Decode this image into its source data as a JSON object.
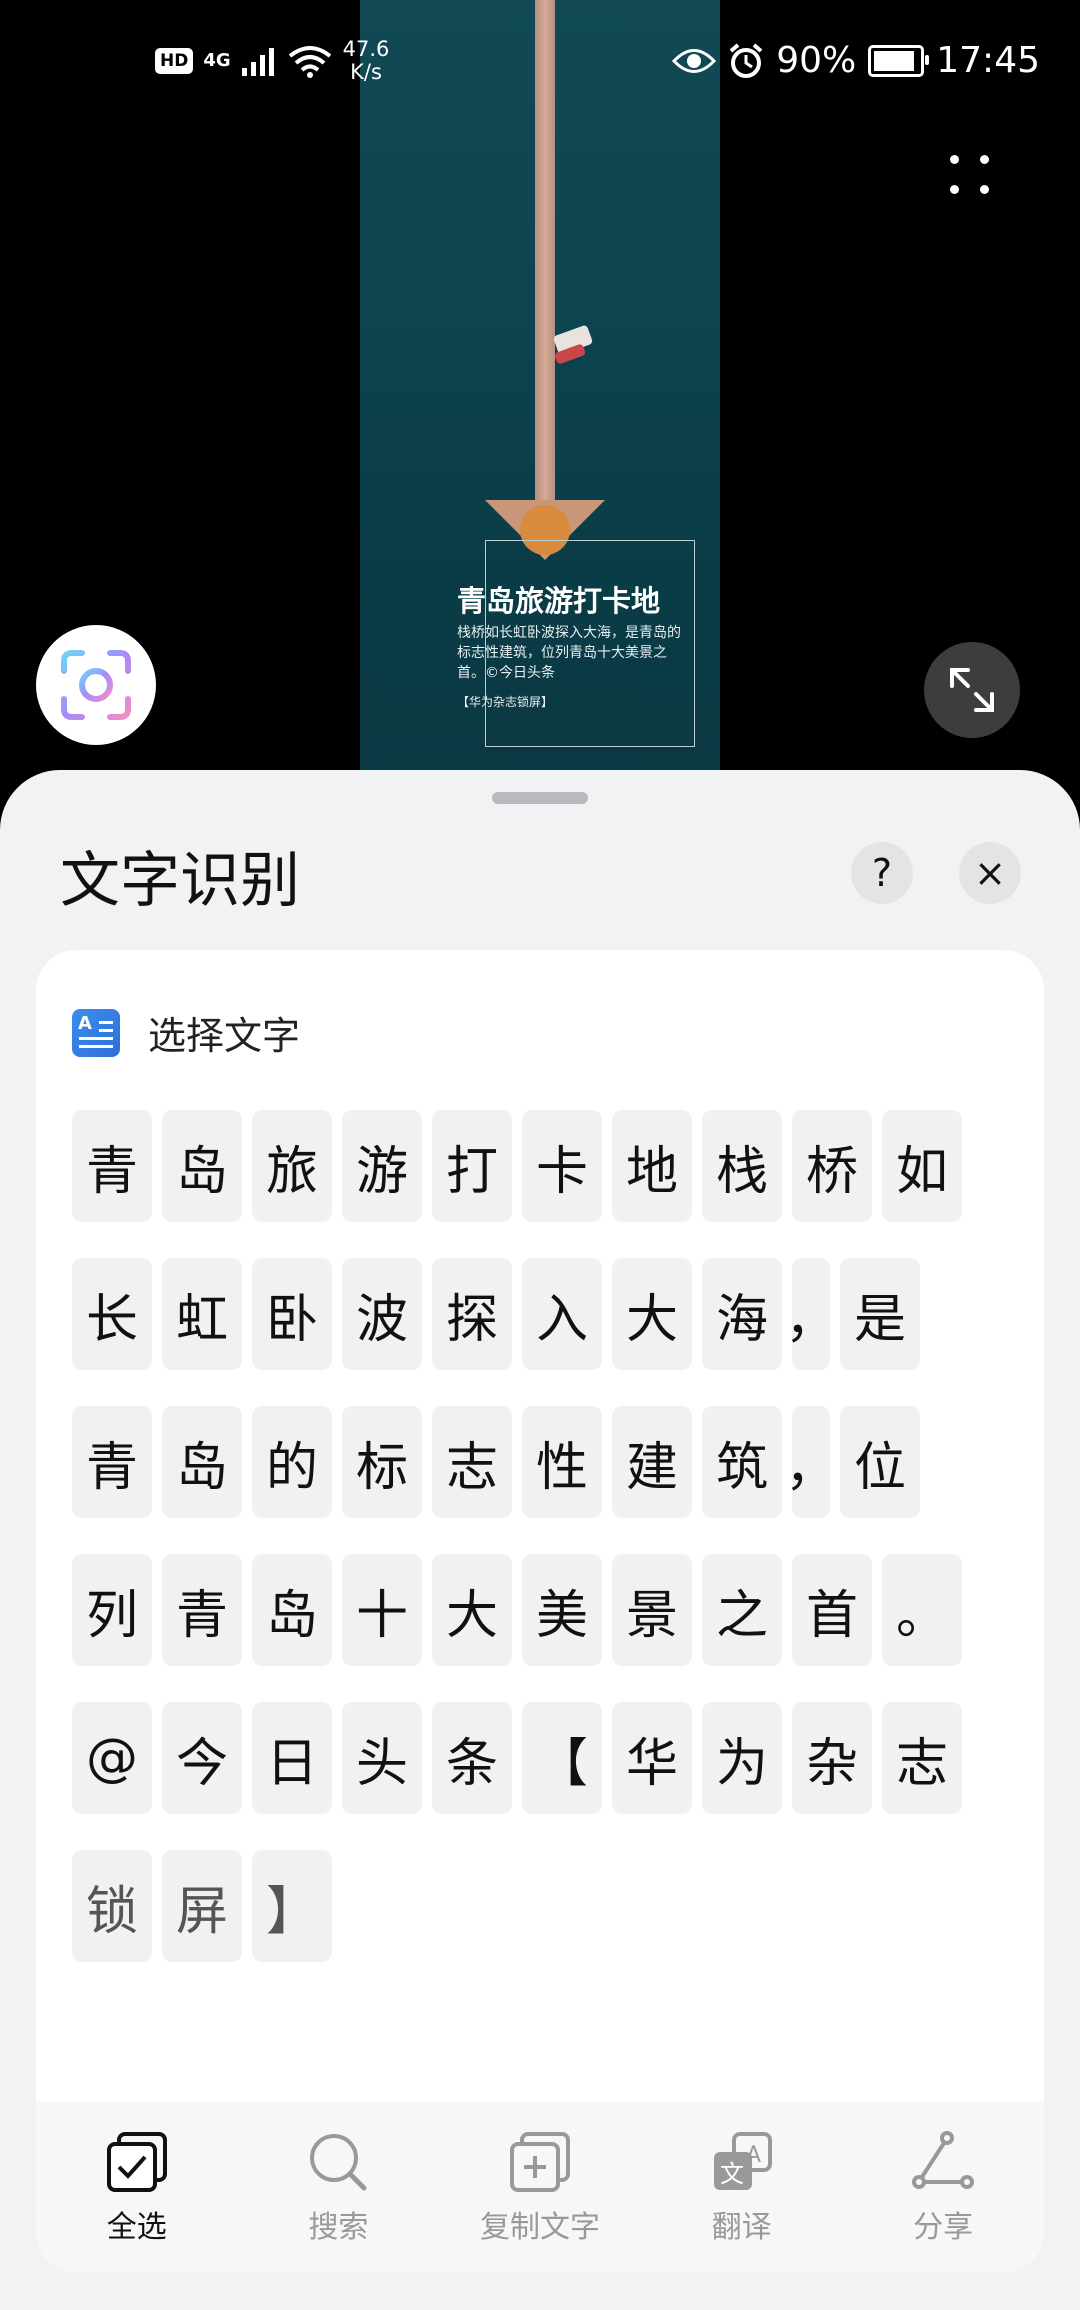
{
  "status_bar": {
    "hd": "HD",
    "network": "4G",
    "speed_value": "47.6",
    "speed_unit": "K/s",
    "battery": "90%",
    "battery_level": 0.9,
    "time": "17:45"
  },
  "wallpaper": {
    "title": "青岛旅游打卡地",
    "description": "栈桥如长虹卧波探入大海，是青岛的标志性建筑，位列青岛十大美景之首。©今日头条",
    "tag": "【华为杂志锁屏】"
  },
  "sheet": {
    "title": "文字识别",
    "help": "?",
    "close": "×",
    "section_label": "选择文字"
  },
  "char_rows": [
    [
      "青",
      "岛",
      "旅",
      "游",
      "打",
      "卡",
      "地",
      "栈",
      "桥",
      "如"
    ],
    [
      "长",
      "虹",
      "卧",
      "波",
      "探",
      "入",
      "大",
      "海",
      "，",
      "是"
    ],
    [
      "青",
      "岛",
      "的",
      "标",
      "志",
      "性",
      "建",
      "筑",
      "，",
      "位"
    ],
    [
      "列",
      "青",
      "岛",
      "十",
      "大",
      "美",
      "景",
      "之",
      "首",
      "。"
    ],
    [
      "@",
      "今",
      "日",
      "头",
      "条",
      "【",
      "华",
      "为",
      "杂",
      "志"
    ],
    [
      "锁",
      "屏",
      "】"
    ]
  ],
  "toolbar": {
    "select_all": "全选",
    "search": "搜索",
    "copy": "复制文字",
    "translate": "翻译",
    "share": "分享"
  }
}
